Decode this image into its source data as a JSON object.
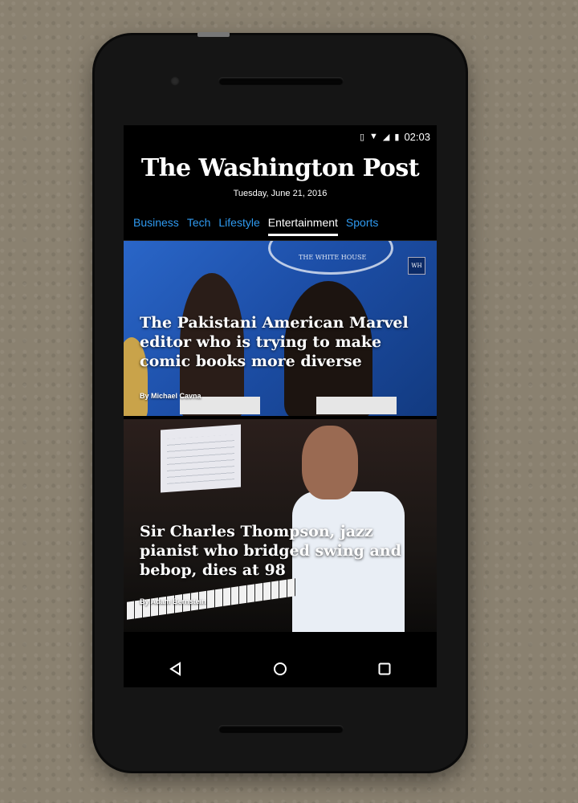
{
  "status_bar": {
    "time": "02:03",
    "icons": [
      "vibrate-icon",
      "wifi-icon",
      "signal-icon",
      "battery-icon"
    ]
  },
  "masthead": {
    "logo": "The Washington Post",
    "date": "Tuesday, June 21, 2016"
  },
  "tabs": [
    {
      "label": "Business",
      "active": false
    },
    {
      "label": "Tech",
      "active": false
    },
    {
      "label": "Lifestyle",
      "active": false
    },
    {
      "label": "Entertainment",
      "active": true
    },
    {
      "label": "Sports",
      "active": false
    }
  ],
  "stories": [
    {
      "headline": "The Pakistani American Marvel editor who is trying to make comic books more diverse",
      "byline": "By Michael Cavna",
      "image_text": "THE WHITE HOUSE",
      "badge": "WH"
    },
    {
      "headline": "Sir Charles Thompson, jazz pianist who bridged swing and bebop, dies at 98",
      "byline": "By Adam Bernstein"
    }
  ],
  "nav_bar": [
    "back-icon",
    "home-icon",
    "recents-icon"
  ],
  "colors": {
    "tab_link": "#2f9af0",
    "tab_active": "#ffffff",
    "background": "#000000"
  }
}
